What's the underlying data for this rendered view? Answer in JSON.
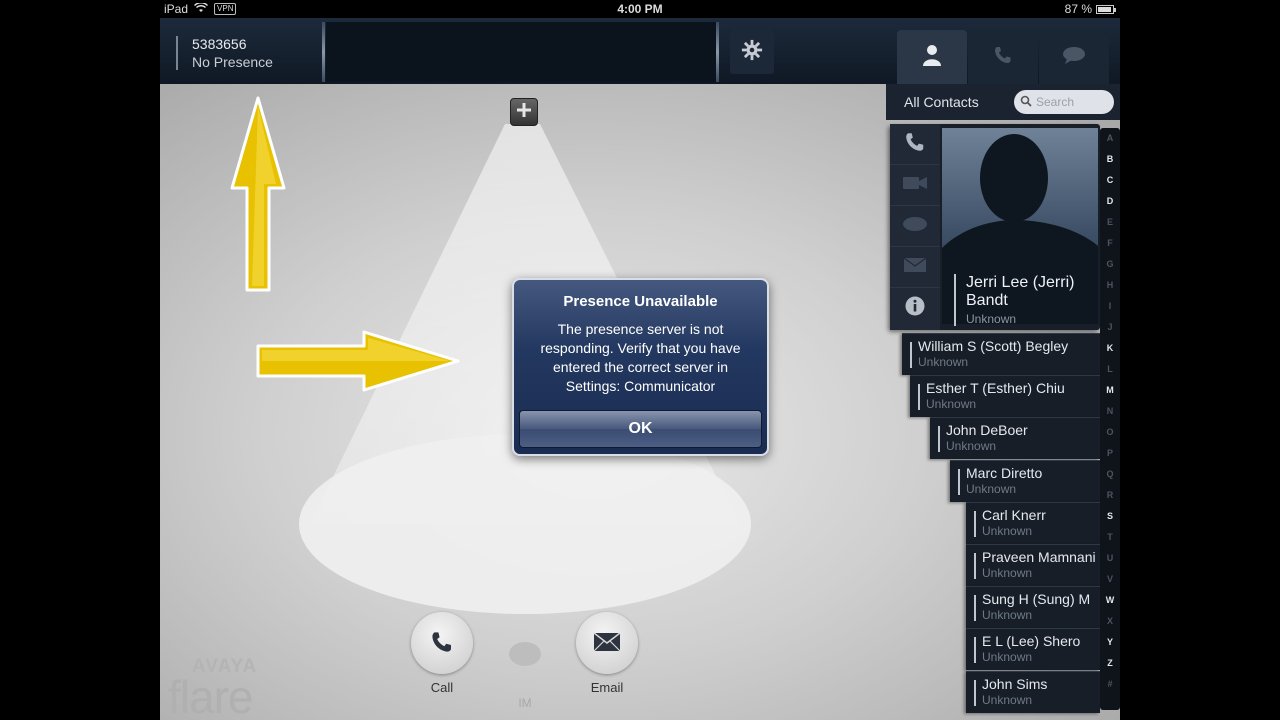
{
  "status_bar": {
    "device": "iPad",
    "vpn": "VPN",
    "time": "4:00 PM",
    "battery": "87 %"
  },
  "header": {
    "extension": "5383656",
    "presence": "No Presence"
  },
  "nav_tabs": [
    {
      "name": "contacts",
      "icon": "person-icon",
      "active": true
    },
    {
      "name": "calls",
      "icon": "phone-icon",
      "active": false
    },
    {
      "name": "messages",
      "icon": "chat-bubble-icon",
      "active": false
    }
  ],
  "contacts": {
    "filter_label": "All Contacts",
    "search_placeholder": "Search",
    "selected": {
      "name": "Jerri Lee (Jerri) Bandt",
      "status": "Unknown"
    },
    "list": [
      {
        "name": "William S (Scott) Begley",
        "status": "Unknown"
      },
      {
        "name": "Esther T (Esther) Chiu",
        "status": "Unknown"
      },
      {
        "name": "John DeBoer",
        "status": "Unknown"
      },
      {
        "name": "Marc Diretto",
        "status": "Unknown"
      },
      {
        "name": "Carl Knerr",
        "status": "Unknown"
      },
      {
        "name": "Praveen Mamnani",
        "status": "Unknown"
      },
      {
        "name": "Sung H (Sung) M",
        "status": "Unknown"
      },
      {
        "name": "E L (Lee) Shero",
        "status": "Unknown"
      },
      {
        "name": "John Sims",
        "status": "Unknown"
      }
    ],
    "alphabet": [
      "A",
      "B",
      "C",
      "D",
      "E",
      "F",
      "G",
      "H",
      "I",
      "J",
      "K",
      "L",
      "M",
      "N",
      "O",
      "P",
      "Q",
      "R",
      "S",
      "T",
      "U",
      "V",
      "W",
      "X",
      "Y",
      "Z",
      "#"
    ],
    "alphabet_active": [
      "B",
      "C",
      "D",
      "K",
      "M",
      "S",
      "W",
      "Y",
      "Z"
    ]
  },
  "dialog": {
    "title": "Presence Unavailable",
    "message": "The presence server is not responding. Verify that you have entered the correct server in Settings: Communicator",
    "ok_label": "OK"
  },
  "actions": {
    "call_label": "Call",
    "im_label": "IM",
    "email_label": "Email"
  },
  "branding": {
    "brand": "AVAYA",
    "product": "flare"
  },
  "colors": {
    "accent_arrow": "#f2c500",
    "dialog_blue": "#233860",
    "top_bar": "#152130"
  }
}
